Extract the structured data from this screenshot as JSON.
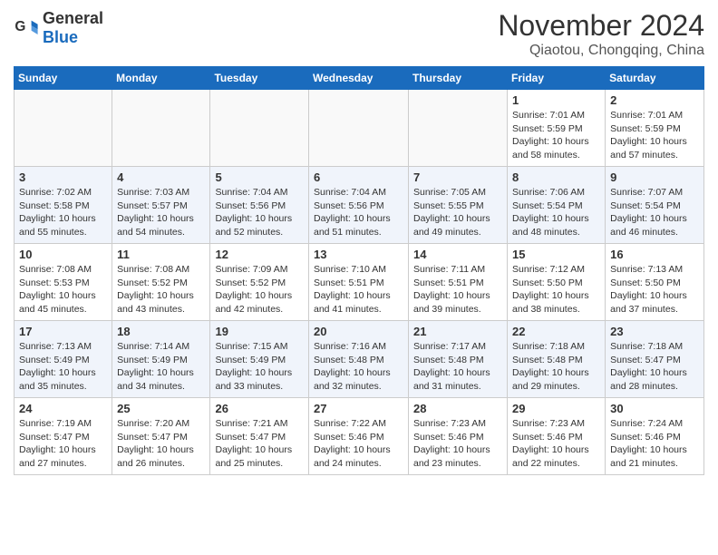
{
  "header": {
    "logo_general": "General",
    "logo_blue": "Blue",
    "title": "November 2024",
    "location": "Qiaotou, Chongqing, China"
  },
  "weekdays": [
    "Sunday",
    "Monday",
    "Tuesday",
    "Wednesday",
    "Thursday",
    "Friday",
    "Saturday"
  ],
  "weeks": [
    [
      {
        "day": "",
        "info": ""
      },
      {
        "day": "",
        "info": ""
      },
      {
        "day": "",
        "info": ""
      },
      {
        "day": "",
        "info": ""
      },
      {
        "day": "",
        "info": ""
      },
      {
        "day": "1",
        "info": "Sunrise: 7:01 AM\nSunset: 5:59 PM\nDaylight: 10 hours and 58 minutes."
      },
      {
        "day": "2",
        "info": "Sunrise: 7:01 AM\nSunset: 5:59 PM\nDaylight: 10 hours and 57 minutes."
      }
    ],
    [
      {
        "day": "3",
        "info": "Sunrise: 7:02 AM\nSunset: 5:58 PM\nDaylight: 10 hours and 55 minutes."
      },
      {
        "day": "4",
        "info": "Sunrise: 7:03 AM\nSunset: 5:57 PM\nDaylight: 10 hours and 54 minutes."
      },
      {
        "day": "5",
        "info": "Sunrise: 7:04 AM\nSunset: 5:56 PM\nDaylight: 10 hours and 52 minutes."
      },
      {
        "day": "6",
        "info": "Sunrise: 7:04 AM\nSunset: 5:56 PM\nDaylight: 10 hours and 51 minutes."
      },
      {
        "day": "7",
        "info": "Sunrise: 7:05 AM\nSunset: 5:55 PM\nDaylight: 10 hours and 49 minutes."
      },
      {
        "day": "8",
        "info": "Sunrise: 7:06 AM\nSunset: 5:54 PM\nDaylight: 10 hours and 48 minutes."
      },
      {
        "day": "9",
        "info": "Sunrise: 7:07 AM\nSunset: 5:54 PM\nDaylight: 10 hours and 46 minutes."
      }
    ],
    [
      {
        "day": "10",
        "info": "Sunrise: 7:08 AM\nSunset: 5:53 PM\nDaylight: 10 hours and 45 minutes."
      },
      {
        "day": "11",
        "info": "Sunrise: 7:08 AM\nSunset: 5:52 PM\nDaylight: 10 hours and 43 minutes."
      },
      {
        "day": "12",
        "info": "Sunrise: 7:09 AM\nSunset: 5:52 PM\nDaylight: 10 hours and 42 minutes."
      },
      {
        "day": "13",
        "info": "Sunrise: 7:10 AM\nSunset: 5:51 PM\nDaylight: 10 hours and 41 minutes."
      },
      {
        "day": "14",
        "info": "Sunrise: 7:11 AM\nSunset: 5:51 PM\nDaylight: 10 hours and 39 minutes."
      },
      {
        "day": "15",
        "info": "Sunrise: 7:12 AM\nSunset: 5:50 PM\nDaylight: 10 hours and 38 minutes."
      },
      {
        "day": "16",
        "info": "Sunrise: 7:13 AM\nSunset: 5:50 PM\nDaylight: 10 hours and 37 minutes."
      }
    ],
    [
      {
        "day": "17",
        "info": "Sunrise: 7:13 AM\nSunset: 5:49 PM\nDaylight: 10 hours and 35 minutes."
      },
      {
        "day": "18",
        "info": "Sunrise: 7:14 AM\nSunset: 5:49 PM\nDaylight: 10 hours and 34 minutes."
      },
      {
        "day": "19",
        "info": "Sunrise: 7:15 AM\nSunset: 5:49 PM\nDaylight: 10 hours and 33 minutes."
      },
      {
        "day": "20",
        "info": "Sunrise: 7:16 AM\nSunset: 5:48 PM\nDaylight: 10 hours and 32 minutes."
      },
      {
        "day": "21",
        "info": "Sunrise: 7:17 AM\nSunset: 5:48 PM\nDaylight: 10 hours and 31 minutes."
      },
      {
        "day": "22",
        "info": "Sunrise: 7:18 AM\nSunset: 5:48 PM\nDaylight: 10 hours and 29 minutes."
      },
      {
        "day": "23",
        "info": "Sunrise: 7:18 AM\nSunset: 5:47 PM\nDaylight: 10 hours and 28 minutes."
      }
    ],
    [
      {
        "day": "24",
        "info": "Sunrise: 7:19 AM\nSunset: 5:47 PM\nDaylight: 10 hours and 27 minutes."
      },
      {
        "day": "25",
        "info": "Sunrise: 7:20 AM\nSunset: 5:47 PM\nDaylight: 10 hours and 26 minutes."
      },
      {
        "day": "26",
        "info": "Sunrise: 7:21 AM\nSunset: 5:47 PM\nDaylight: 10 hours and 25 minutes."
      },
      {
        "day": "27",
        "info": "Sunrise: 7:22 AM\nSunset: 5:46 PM\nDaylight: 10 hours and 24 minutes."
      },
      {
        "day": "28",
        "info": "Sunrise: 7:23 AM\nSunset: 5:46 PM\nDaylight: 10 hours and 23 minutes."
      },
      {
        "day": "29",
        "info": "Sunrise: 7:23 AM\nSunset: 5:46 PM\nDaylight: 10 hours and 22 minutes."
      },
      {
        "day": "30",
        "info": "Sunrise: 7:24 AM\nSunset: 5:46 PM\nDaylight: 10 hours and 21 minutes."
      }
    ]
  ]
}
